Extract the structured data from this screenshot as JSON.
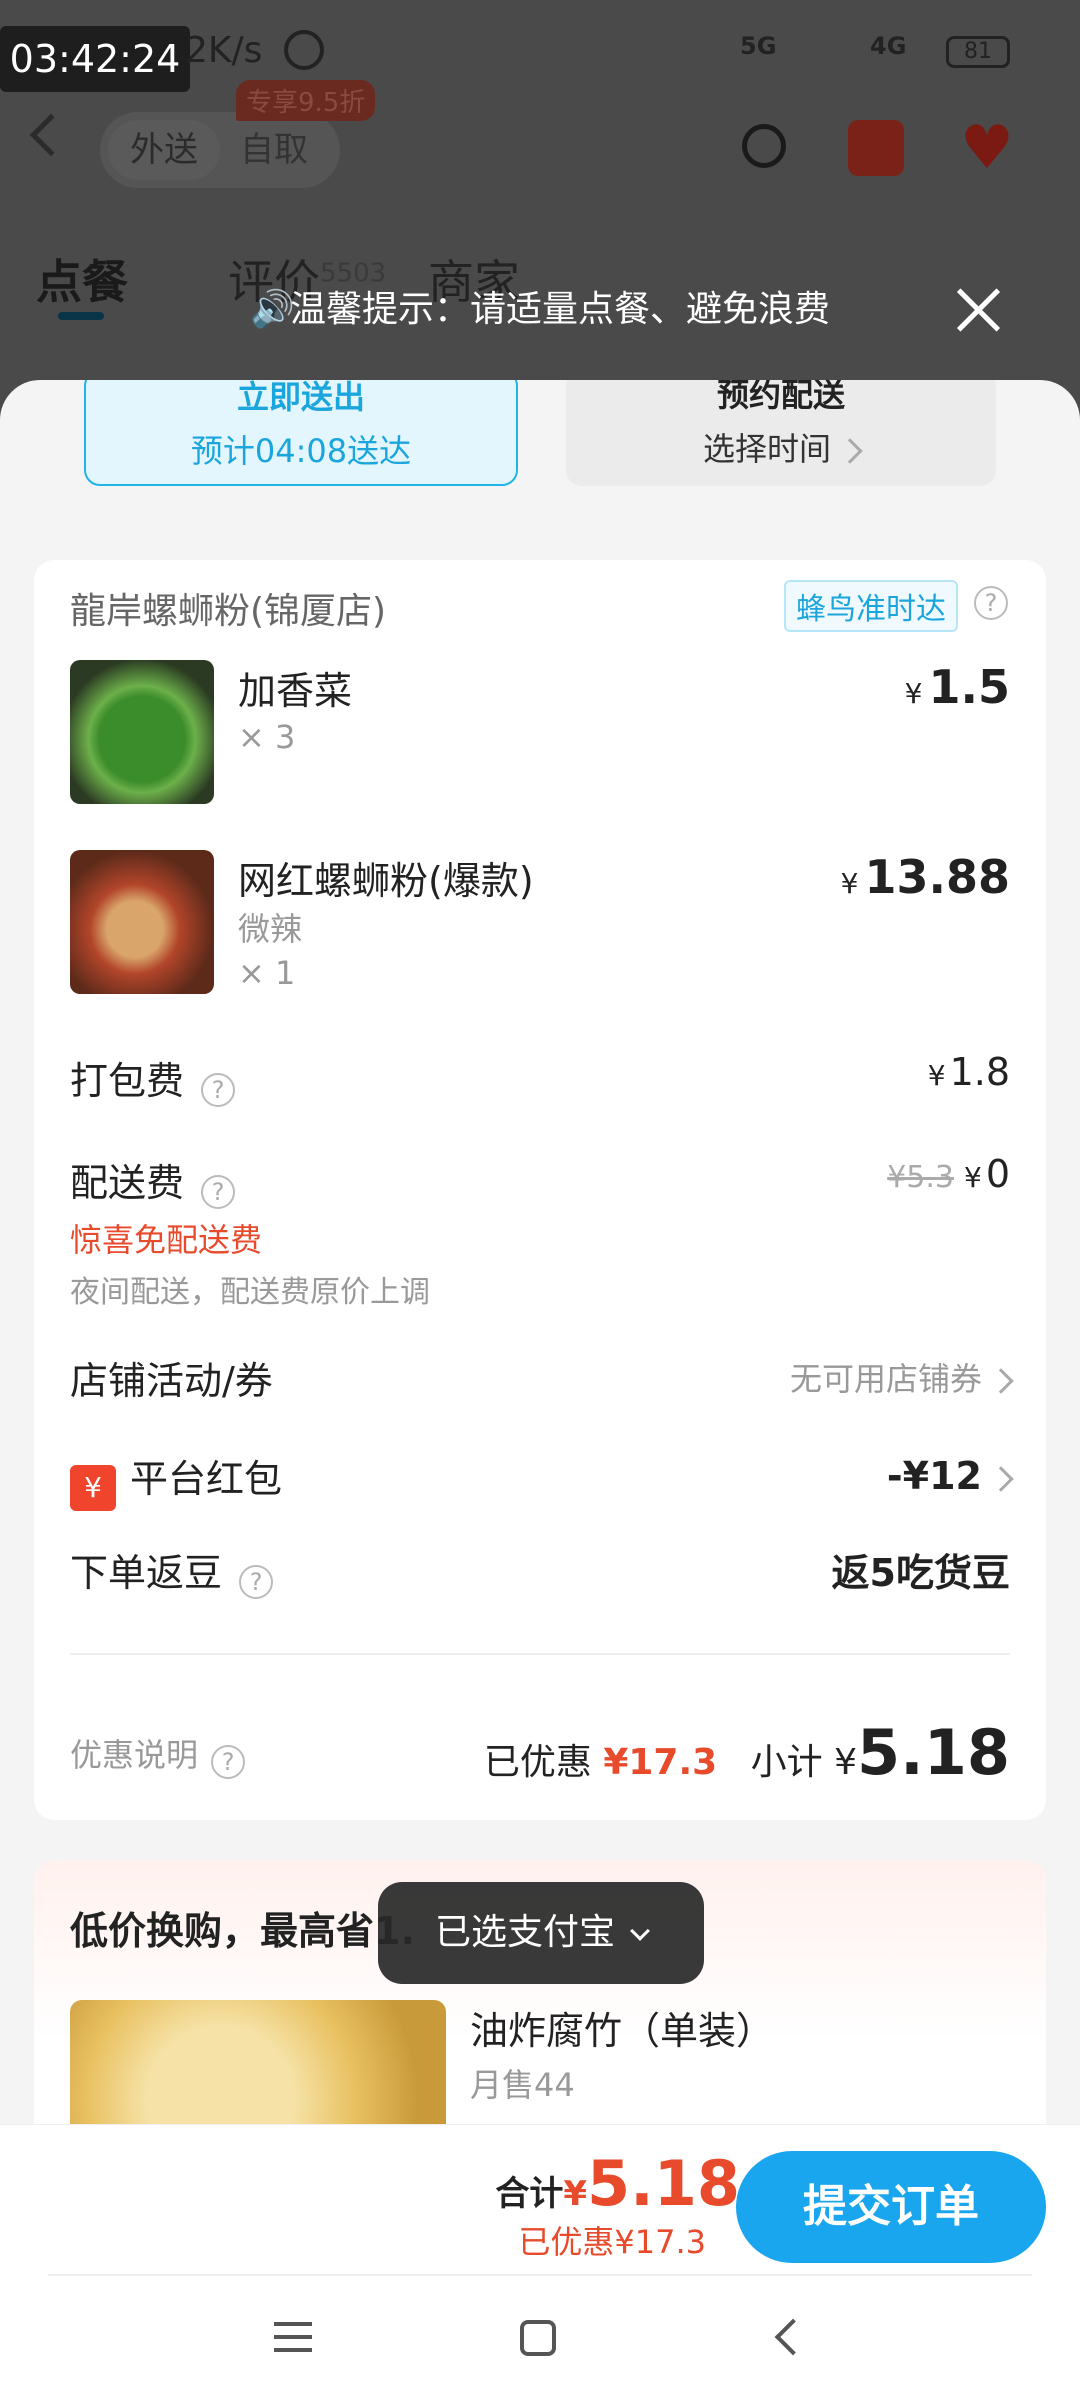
{
  "status_bar": {
    "time": "03:42:24",
    "network_speed": "2K/s",
    "signal_1": "5G",
    "signal_2": "4G",
    "battery": "81"
  },
  "background_app": {
    "segment": {
      "delivery": "外送",
      "pickup": "自取"
    },
    "promo_badge": "专享9.5折",
    "tabs": [
      {
        "label": "点餐"
      },
      {
        "label": "评价",
        "count": "5503"
      },
      {
        "label": "商家"
      }
    ]
  },
  "tip_banner": {
    "text": "温馨提示：请适量点餐、避免浪费"
  },
  "delivery_options": {
    "now": {
      "title": "立即送出",
      "eta": "预计04:08送达"
    },
    "scheduled": {
      "title": "预约配送",
      "action": "选择时间"
    }
  },
  "order": {
    "shop_name": "龍岸螺蛳粉(锦厦店)",
    "punctual_tag": "蜂鸟准时达",
    "items": [
      {
        "name": "加香菜",
        "spec": "",
        "qty": "× 3",
        "price": "1.5"
      },
      {
        "name": "网红螺蛳粉(爆款)",
        "spec": "微辣",
        "qty": "× 1",
        "price": "13.88"
      }
    ],
    "packing_fee": {
      "label": "打包费",
      "value": "1.8"
    },
    "delivery_fee": {
      "label": "配送费",
      "original": "¥5.3",
      "value": "0",
      "promo": "惊喜免配送费",
      "note": "夜间配送，配送费原价上调"
    },
    "shop_coupon": {
      "label": "店铺活动/券",
      "value": "无可用店铺券"
    },
    "platform_redpack": {
      "label": "平台红包",
      "value": "-¥12",
      "icon_text": "¥"
    },
    "beans": {
      "label": "下单返豆",
      "value": "返5吃货豆"
    },
    "discount_note_label": "优惠说明",
    "saved_label": "已优惠",
    "saved_value": "¥17.3",
    "subtotal_label": "小计",
    "subtotal_yen": "¥",
    "subtotal_value": "5.18"
  },
  "exchange": {
    "title": "低价换购，最高省1.",
    "product_name": "油炸腐竹（单装）",
    "monthly_sales": "月售44"
  },
  "toast": {
    "text": "已选支付宝"
  },
  "footer": {
    "total_label": "合计",
    "total_yen": "¥",
    "total_value": "5.18",
    "saved_text": "已优惠¥17.3",
    "submit_label": "提交订单"
  },
  "currency_symbol": "¥",
  "colors": {
    "accent_blue": "#1aa6ee",
    "price_red": "#e84a2c"
  }
}
